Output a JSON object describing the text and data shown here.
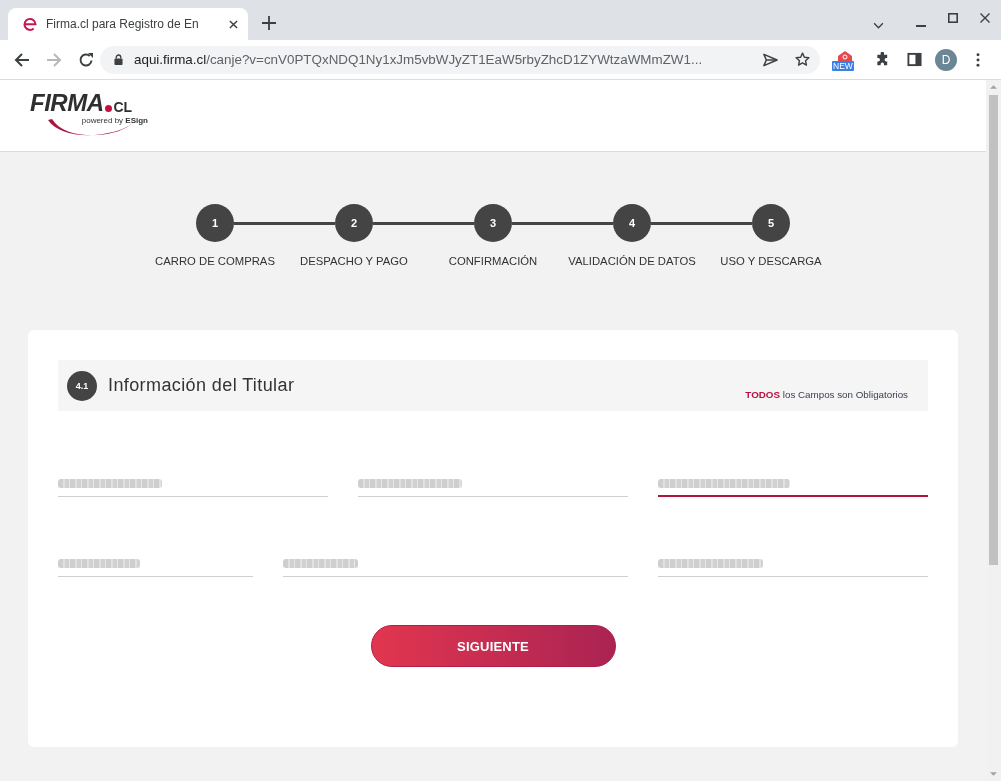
{
  "browser": {
    "tab": {
      "title": "Firma.cl para Registro de En",
      "selected": true
    },
    "navigation": {
      "back_disabled": false,
      "forward_disabled": true
    },
    "address": {
      "host": "aqui.firma.cl",
      "path": "/canje?v=cnV0PTQxNDQ1Ny1xJm5vbWJyZT1EaW5rbyZhcD1ZYWtzaWMmZW1..."
    },
    "extension_badge": "NEW",
    "profile_initial": "D"
  },
  "logo": {
    "wordmark": "FIRMA",
    "suffix": "CL",
    "tagline": "powered by **ESign**"
  },
  "steps": [
    {
      "number": "1",
      "label": "CARRO DE COMPRAS"
    },
    {
      "number": "2",
      "label": "DESPACHO Y PAGO"
    },
    {
      "number": "3",
      "label": "CONFIRMACIÓN"
    },
    {
      "number": "4",
      "label": "VALIDACIÓN DE DATOS"
    },
    {
      "number": "5",
      "label": "USO Y DESCARGA"
    }
  ],
  "section": {
    "number": "4.1",
    "title": "Información del Titular",
    "note": "**TODOS** los Campos son Obligatorios"
  },
  "form": {
    "rows": [
      {
        "fields": [
          {
            "focused": false
          },
          {
            "focused": false
          },
          {
            "focused": true
          }
        ]
      },
      {
        "fields": [
          {
            "focused": false
          },
          {
            "focused": false
          },
          {
            "focused": false
          }
        ]
      }
    ]
  },
  "submit_button": "SIGUIENTE"
}
